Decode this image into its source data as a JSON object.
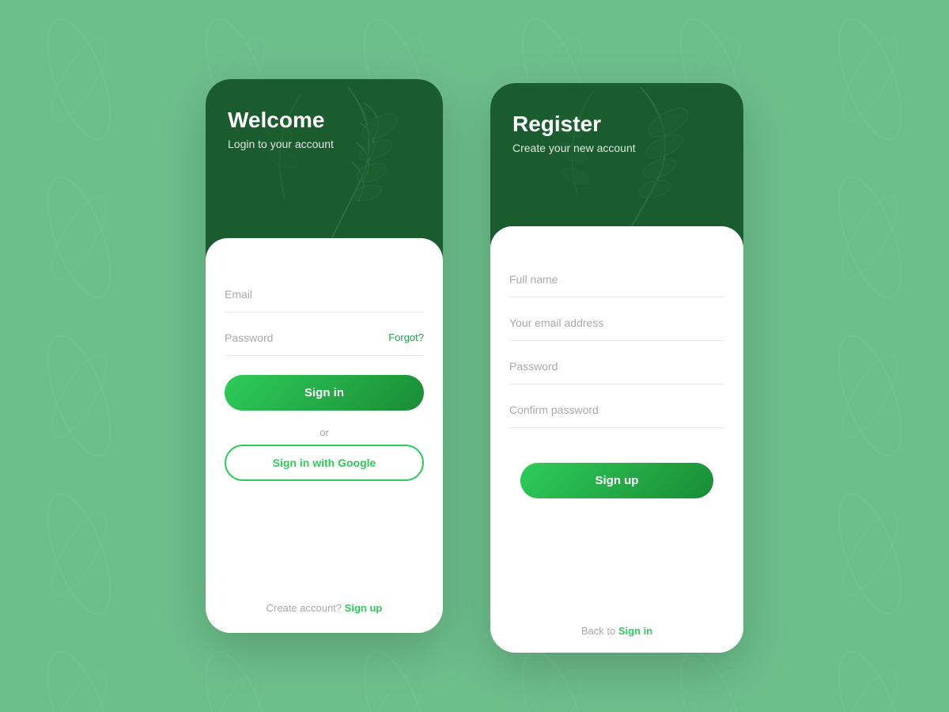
{
  "login": {
    "title": "Welcome",
    "subtitle": "Login to your account",
    "email_placeholder": "Email",
    "password_placeholder": "Password",
    "forgot_label": "Forgot?",
    "signin_label": "Sign in",
    "or_label": "or",
    "google_label": "Sign in with Google",
    "create_text": "Create account?",
    "signup_link": "Sign up"
  },
  "register": {
    "title": "Register",
    "subtitle": "Create your new account",
    "fullname_placeholder": "Full name",
    "email_placeholder": "Your email address",
    "password_placeholder": "Password",
    "confirm_placeholder": "Confirm password",
    "signup_label": "Sign up",
    "back_text": "Back to",
    "signin_link": "Sign in"
  },
  "colors": {
    "green_primary": "#2ecc5a",
    "green_dark": "#1a5c2e",
    "bg": "#6dbf8a"
  }
}
